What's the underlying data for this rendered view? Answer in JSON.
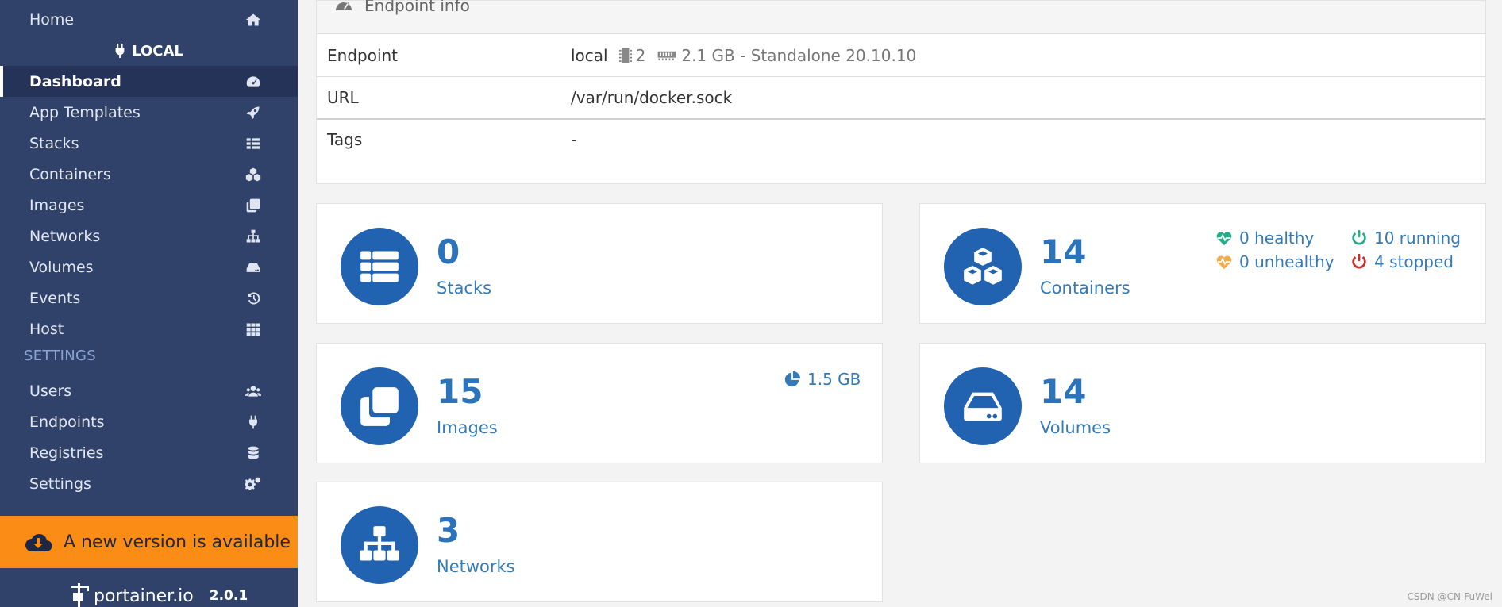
{
  "sidebar": {
    "home": "Home",
    "local": "LOCAL",
    "items": [
      "Dashboard",
      "App Templates",
      "Stacks",
      "Containers",
      "Images",
      "Networks",
      "Volumes",
      "Events",
      "Host"
    ],
    "settings_section": "SETTINGS",
    "settings_items": [
      "Users",
      "Endpoints",
      "Registries",
      "Settings"
    ],
    "update_banner": "A new version is available",
    "brand": "portainer.io",
    "version": "2.0.1"
  },
  "endpoint_info": {
    "title": "Endpoint info",
    "rows": {
      "endpoint_label": "Endpoint",
      "endpoint_name": "local",
      "cpu": "2",
      "memory": "2.1 GB - Standalone 20.10.10",
      "url_label": "URL",
      "url_value": "/var/run/docker.sock",
      "tags_label": "Tags",
      "tags_value": "-"
    }
  },
  "cards": {
    "stacks": {
      "count": "0",
      "label": "Stacks"
    },
    "containers": {
      "count": "14",
      "label": "Containers",
      "healthy": "0 healthy",
      "unhealthy": "0 unhealthy",
      "running": "10 running",
      "stopped": "4 stopped"
    },
    "images": {
      "count": "15",
      "label": "Images",
      "size": "1.5 GB"
    },
    "volumes": {
      "count": "14",
      "label": "Volumes"
    },
    "networks": {
      "count": "3",
      "label": "Networks"
    }
  },
  "colors": {
    "sidebar_bg": "#30426a",
    "accent_blue": "#2263b1",
    "banner_orange": "#fb8c16",
    "healthy_green": "#23ae89",
    "unhealthy_orange": "#f0ad4e",
    "stopped_red": "#c9302c"
  },
  "watermark": "CSDN @CN-FuWei"
}
